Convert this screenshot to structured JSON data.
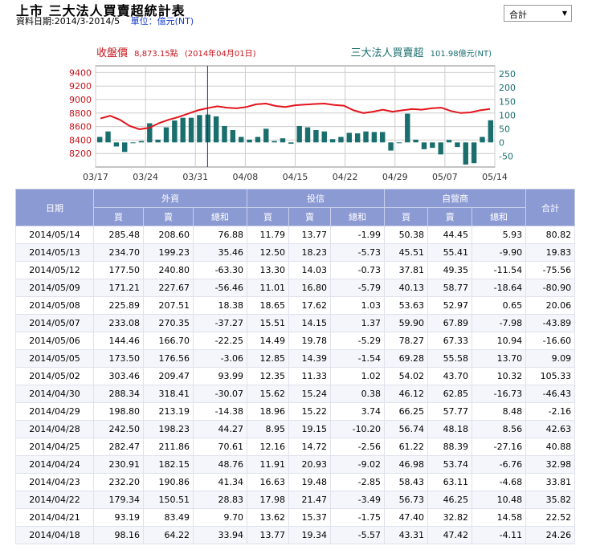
{
  "header": {
    "title": "上市 三大法人買賣超統計表",
    "date_range": "資料日期:2014/3-2014/5",
    "unit_label": "單位：",
    "unit_value": "億元(NT)"
  },
  "select": {
    "value": "合計"
  },
  "chart_data": {
    "type": "bar",
    "left_label": "收盤價",
    "left_value": "8,873.15點",
    "left_date": "(2014年04月01日)",
    "right_label": "三大法人買賣超",
    "right_value": "101.98億元(NT)",
    "x_ticks": [
      "03/17",
      "03/24",
      "03/31",
      "04/08",
      "04/15",
      "04/22",
      "04/29",
      "05/07",
      "05/14"
    ],
    "left_axis": [
      8200,
      8400,
      8600,
      8800,
      9000,
      9200,
      9400
    ],
    "left_ylim": [
      8000,
      9500
    ],
    "right_axis": [
      -50,
      0,
      50,
      100,
      150,
      200,
      250
    ],
    "right_ylim": [
      -90,
      280
    ],
    "colors": {
      "price_line": "#e2141c",
      "bars": "#1a6e6e",
      "left_axis": "#c8141c",
      "right_axis": "#1a6e6e",
      "cursor": "#1a2fa8"
    },
    "cursor_index": 11,
    "close": [
      8720,
      8760,
      8700,
      8610,
      8560,
      8580,
      8650,
      8700,
      8740,
      8790,
      8840,
      8873,
      8900,
      8880,
      8870,
      8890,
      8930,
      8940,
      8905,
      8890,
      8915,
      8925,
      8935,
      8940,
      8920,
      8910,
      8840,
      8800,
      8820,
      8850,
      8820,
      8840,
      8860,
      8850,
      8870,
      8880,
      8830,
      8800,
      8810,
      8840,
      8860
    ],
    "net": [
      20,
      40,
      -15,
      -35,
      -2,
      5,
      70,
      10,
      55,
      80,
      90,
      90,
      100,
      102,
      95,
      60,
      45,
      20,
      10,
      20,
      50,
      5,
      15,
      -5,
      60,
      55,
      45,
      40,
      12,
      20,
      35,
      33,
      40,
      38,
      38,
      -30,
      0,
      105,
      10,
      -25,
      -20,
      -44,
      9,
      -17,
      -81,
      -76,
      20,
      81
    ]
  },
  "table": {
    "group_headers": {
      "date": "日期",
      "foreign": "外資",
      "trust": "投信",
      "dealer": "自營商",
      "total": "合計"
    },
    "sub_headers": [
      "買",
      "賣",
      "總和",
      "買",
      "賣",
      "總和",
      "買",
      "賣",
      "總和"
    ],
    "rows": [
      [
        "2014/05/14",
        "285.48",
        "208.60",
        "76.88",
        "11.79",
        "13.77",
        "-1.99",
        "50.38",
        "44.45",
        "5.93",
        "80.82"
      ],
      [
        "2014/05/13",
        "234.70",
        "199.23",
        "35.46",
        "12.50",
        "18.23",
        "-5.73",
        "45.51",
        "55.41",
        "-9.90",
        "19.83"
      ],
      [
        "2014/05/12",
        "177.50",
        "240.80",
        "-63.30",
        "13.30",
        "14.03",
        "-0.73",
        "37.81",
        "49.35",
        "-11.54",
        "-75.56"
      ],
      [
        "2014/05/09",
        "171.21",
        "227.67",
        "-56.46",
        "11.01",
        "16.80",
        "-5.79",
        "40.13",
        "58.77",
        "-18.64",
        "-80.90"
      ],
      [
        "2014/05/08",
        "225.89",
        "207.51",
        "18.38",
        "18.65",
        "17.62",
        "1.03",
        "53.63",
        "52.97",
        "0.65",
        "20.06"
      ],
      [
        "2014/05/07",
        "233.08",
        "270.35",
        "-37.27",
        "15.51",
        "14.15",
        "1.37",
        "59.90",
        "67.89",
        "-7.98",
        "-43.89"
      ],
      [
        "2014/05/06",
        "144.46",
        "166.70",
        "-22.25",
        "14.49",
        "19.78",
        "-5.29",
        "78.27",
        "67.33",
        "10.94",
        "-16.60"
      ],
      [
        "2014/05/05",
        "173.50",
        "176.56",
        "-3.06",
        "12.85",
        "14.39",
        "-1.54",
        "69.28",
        "55.58",
        "13.70",
        "9.09"
      ],
      [
        "2014/05/02",
        "303.46",
        "209.47",
        "93.99",
        "12.35",
        "11.33",
        "1.02",
        "54.02",
        "43.70",
        "10.32",
        "105.33"
      ],
      [
        "2014/04/30",
        "288.34",
        "318.41",
        "-30.07",
        "15.62",
        "15.24",
        "0.38",
        "46.12",
        "62.85",
        "-16.73",
        "-46.43"
      ],
      [
        "2014/04/29",
        "198.80",
        "213.19",
        "-14.38",
        "18.96",
        "15.22",
        "3.74",
        "66.25",
        "57.77",
        "8.48",
        "-2.16"
      ],
      [
        "2014/04/28",
        "242.50",
        "198.23",
        "44.27",
        "8.95",
        "19.15",
        "-10.20",
        "56.74",
        "48.18",
        "8.56",
        "42.63"
      ],
      [
        "2014/04/25",
        "282.47",
        "211.86",
        "70.61",
        "12.16",
        "14.72",
        "-2.56",
        "61.22",
        "88.39",
        "-27.16",
        "40.88"
      ],
      [
        "2014/04/24",
        "230.91",
        "182.15",
        "48.76",
        "11.91",
        "20.93",
        "-9.02",
        "46.98",
        "53.74",
        "-6.76",
        "32.98"
      ],
      [
        "2014/04/23",
        "232.20",
        "190.86",
        "41.34",
        "16.63",
        "19.48",
        "-2.85",
        "58.43",
        "63.11",
        "-4.68",
        "33.81"
      ],
      [
        "2014/04/22",
        "179.34",
        "150.51",
        "28.83",
        "17.98",
        "21.47",
        "-3.49",
        "56.73",
        "46.25",
        "10.48",
        "35.82"
      ],
      [
        "2014/04/21",
        "93.19",
        "83.49",
        "9.70",
        "13.62",
        "15.37",
        "-1.75",
        "47.40",
        "32.82",
        "14.58",
        "22.52"
      ],
      [
        "2014/04/18",
        "98.16",
        "64.22",
        "33.94",
        "13.77",
        "19.34",
        "-5.57",
        "43.31",
        "47.42",
        "-4.11",
        "24.26"
      ]
    ]
  }
}
